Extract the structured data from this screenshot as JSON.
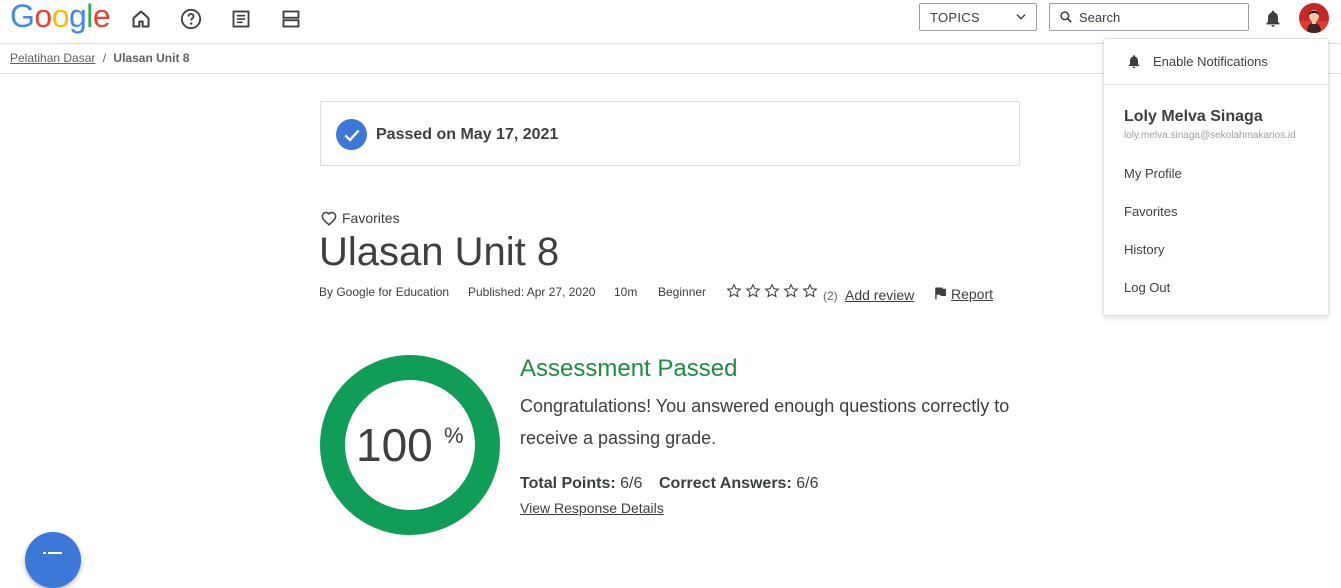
{
  "header": {
    "logo_letters": [
      {
        "ch": "G",
        "color": "#4285F4"
      },
      {
        "ch": "o",
        "color": "#EA4335"
      },
      {
        "ch": "o",
        "color": "#FBBC05"
      },
      {
        "ch": "g",
        "color": "#4285F4"
      },
      {
        "ch": "l",
        "color": "#34A853"
      },
      {
        "ch": "e",
        "color": "#EA4335"
      }
    ],
    "nav_icons": [
      "home-icon",
      "help-icon",
      "article-icon",
      "view-agenda-icon"
    ],
    "topics_label": "TOPICS",
    "search_placeholder": "Search"
  },
  "breadcrumb": {
    "parent": "Pelatihan Dasar",
    "separator": "/",
    "current": "Ulasan Unit 8"
  },
  "banner": {
    "text": "Passed on May 17, 2021"
  },
  "course": {
    "favorites_label": "Favorites",
    "title": "Ulasan Unit 8",
    "author": "By Google for Education",
    "published": "Published: Apr 27, 2020",
    "duration": "10m",
    "level": "Beginner",
    "rating_stars": 0,
    "review_count": "(2)",
    "add_review_label": "Add review",
    "report_label": "Report"
  },
  "result": {
    "percent": "100",
    "percent_sign": "%",
    "score_fraction": 1.0,
    "heading": "Assessment Passed",
    "message": "Congratulations! You answered enough questions correctly to receive a passing grade.",
    "total_points_label": "Total Points:",
    "total_points_value": "6/6",
    "correct_answers_label": "Correct Answers:",
    "correct_answers_value": "6/6",
    "view_details_label": "View Response Details"
  },
  "account_menu": {
    "enable_notifications": "Enable Notifications",
    "user_name": "Loly Melva Sinaga",
    "user_email": "loly.melva.sinaga@sekolahmakarios.id",
    "items": [
      "My Profile",
      "Favorites",
      "History",
      "Log Out"
    ]
  },
  "colors": {
    "accent_blue": "#3c78d8",
    "pass_green": "#1e8e3e",
    "ring_green": "#0f9d58"
  }
}
